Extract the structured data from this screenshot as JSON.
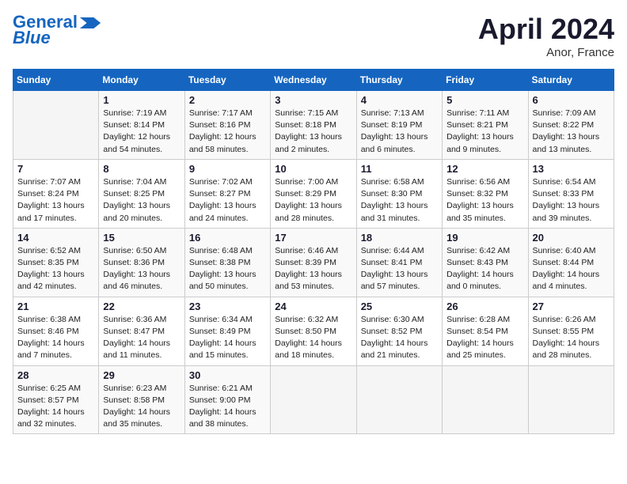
{
  "header": {
    "logo_line1": "General",
    "logo_line2": "Blue",
    "month": "April 2024",
    "location": "Anor, France"
  },
  "days_of_week": [
    "Sunday",
    "Monday",
    "Tuesday",
    "Wednesday",
    "Thursday",
    "Friday",
    "Saturday"
  ],
  "weeks": [
    [
      {
        "day": "",
        "info": ""
      },
      {
        "day": "1",
        "info": "Sunrise: 7:19 AM\nSunset: 8:14 PM\nDaylight: 12 hours\nand 54 minutes."
      },
      {
        "day": "2",
        "info": "Sunrise: 7:17 AM\nSunset: 8:16 PM\nDaylight: 12 hours\nand 58 minutes."
      },
      {
        "day": "3",
        "info": "Sunrise: 7:15 AM\nSunset: 8:18 PM\nDaylight: 13 hours\nand 2 minutes."
      },
      {
        "day": "4",
        "info": "Sunrise: 7:13 AM\nSunset: 8:19 PM\nDaylight: 13 hours\nand 6 minutes."
      },
      {
        "day": "5",
        "info": "Sunrise: 7:11 AM\nSunset: 8:21 PM\nDaylight: 13 hours\nand 9 minutes."
      },
      {
        "day": "6",
        "info": "Sunrise: 7:09 AM\nSunset: 8:22 PM\nDaylight: 13 hours\nand 13 minutes."
      }
    ],
    [
      {
        "day": "7",
        "info": "Sunrise: 7:07 AM\nSunset: 8:24 PM\nDaylight: 13 hours\nand 17 minutes."
      },
      {
        "day": "8",
        "info": "Sunrise: 7:04 AM\nSunset: 8:25 PM\nDaylight: 13 hours\nand 20 minutes."
      },
      {
        "day": "9",
        "info": "Sunrise: 7:02 AM\nSunset: 8:27 PM\nDaylight: 13 hours\nand 24 minutes."
      },
      {
        "day": "10",
        "info": "Sunrise: 7:00 AM\nSunset: 8:29 PM\nDaylight: 13 hours\nand 28 minutes."
      },
      {
        "day": "11",
        "info": "Sunrise: 6:58 AM\nSunset: 8:30 PM\nDaylight: 13 hours\nand 31 minutes."
      },
      {
        "day": "12",
        "info": "Sunrise: 6:56 AM\nSunset: 8:32 PM\nDaylight: 13 hours\nand 35 minutes."
      },
      {
        "day": "13",
        "info": "Sunrise: 6:54 AM\nSunset: 8:33 PM\nDaylight: 13 hours\nand 39 minutes."
      }
    ],
    [
      {
        "day": "14",
        "info": "Sunrise: 6:52 AM\nSunset: 8:35 PM\nDaylight: 13 hours\nand 42 minutes."
      },
      {
        "day": "15",
        "info": "Sunrise: 6:50 AM\nSunset: 8:36 PM\nDaylight: 13 hours\nand 46 minutes."
      },
      {
        "day": "16",
        "info": "Sunrise: 6:48 AM\nSunset: 8:38 PM\nDaylight: 13 hours\nand 50 minutes."
      },
      {
        "day": "17",
        "info": "Sunrise: 6:46 AM\nSunset: 8:39 PM\nDaylight: 13 hours\nand 53 minutes."
      },
      {
        "day": "18",
        "info": "Sunrise: 6:44 AM\nSunset: 8:41 PM\nDaylight: 13 hours\nand 57 minutes."
      },
      {
        "day": "19",
        "info": "Sunrise: 6:42 AM\nSunset: 8:43 PM\nDaylight: 14 hours\nand 0 minutes."
      },
      {
        "day": "20",
        "info": "Sunrise: 6:40 AM\nSunset: 8:44 PM\nDaylight: 14 hours\nand 4 minutes."
      }
    ],
    [
      {
        "day": "21",
        "info": "Sunrise: 6:38 AM\nSunset: 8:46 PM\nDaylight: 14 hours\nand 7 minutes."
      },
      {
        "day": "22",
        "info": "Sunrise: 6:36 AM\nSunset: 8:47 PM\nDaylight: 14 hours\nand 11 minutes."
      },
      {
        "day": "23",
        "info": "Sunrise: 6:34 AM\nSunset: 8:49 PM\nDaylight: 14 hours\nand 15 minutes."
      },
      {
        "day": "24",
        "info": "Sunrise: 6:32 AM\nSunset: 8:50 PM\nDaylight: 14 hours\nand 18 minutes."
      },
      {
        "day": "25",
        "info": "Sunrise: 6:30 AM\nSunset: 8:52 PM\nDaylight: 14 hours\nand 21 minutes."
      },
      {
        "day": "26",
        "info": "Sunrise: 6:28 AM\nSunset: 8:54 PM\nDaylight: 14 hours\nand 25 minutes."
      },
      {
        "day": "27",
        "info": "Sunrise: 6:26 AM\nSunset: 8:55 PM\nDaylight: 14 hours\nand 28 minutes."
      }
    ],
    [
      {
        "day": "28",
        "info": "Sunrise: 6:25 AM\nSunset: 8:57 PM\nDaylight: 14 hours\nand 32 minutes."
      },
      {
        "day": "29",
        "info": "Sunrise: 6:23 AM\nSunset: 8:58 PM\nDaylight: 14 hours\nand 35 minutes."
      },
      {
        "day": "30",
        "info": "Sunrise: 6:21 AM\nSunset: 9:00 PM\nDaylight: 14 hours\nand 38 minutes."
      },
      {
        "day": "",
        "info": ""
      },
      {
        "day": "",
        "info": ""
      },
      {
        "day": "",
        "info": ""
      },
      {
        "day": "",
        "info": ""
      }
    ]
  ]
}
